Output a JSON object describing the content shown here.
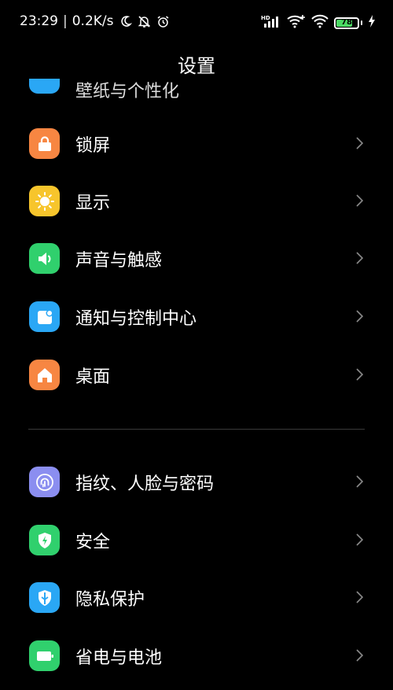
{
  "status_bar": {
    "time": "23:29",
    "network_speed": "0.2K/s",
    "battery_level": "78",
    "battery_percent": 78,
    "battery_color": "#4cd964"
  },
  "title": "设置",
  "settings": {
    "partial_item": {
      "label": "壁纸与个性化",
      "icon": "partial-icon",
      "color": "#2aa7f5"
    },
    "group1": [
      {
        "label": "锁屏",
        "icon": "lock-icon",
        "color": "#f78642"
      },
      {
        "label": "显示",
        "icon": "sun-icon",
        "color": "#f7c52c"
      },
      {
        "label": "声音与触感",
        "icon": "speaker-icon",
        "color": "#30d06d"
      },
      {
        "label": "通知与控制中心",
        "icon": "notification-icon",
        "color": "#2aa7f5"
      },
      {
        "label": "桌面",
        "icon": "home-icon",
        "color": "#f78642"
      }
    ],
    "group2": [
      {
        "label": "指纹、人脸与密码",
        "icon": "fingerprint-icon",
        "color": "#8b8ef0"
      },
      {
        "label": "安全",
        "icon": "shield-icon",
        "color": "#30d06d"
      },
      {
        "label": "隐私保护",
        "icon": "privacy-icon",
        "color": "#2aa7f5"
      },
      {
        "label": "省电与电池",
        "icon": "battery-saver-icon",
        "color": "#30d06d"
      }
    ]
  }
}
